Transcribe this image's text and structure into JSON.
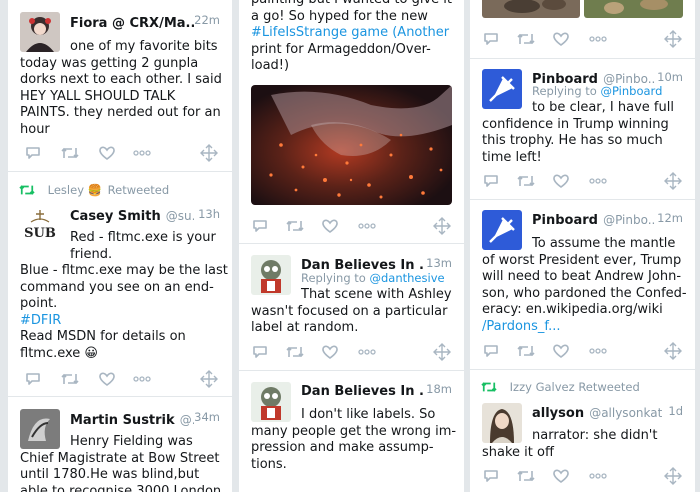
{
  "tweets": [
    {
      "name": "Fiora @ CRX/Ma...",
      "time": "22m",
      "text_lines": [
        "one of my favorite bits",
        "today was getting 2 gunpla",
        "dorks next to each other. I said",
        "HEY YALL SHOULD TALK",
        "PAINTS. they nerded out for an",
        "hour"
      ]
    },
    {
      "retweeted_by": "Lesley",
      "retweeted_emoji": "🍔",
      "retweeted_label": "Retweeted",
      "name": "Casey Smith",
      "handle": "@su...",
      "time": "13h",
      "avatar_text": "SUB",
      "text_lines": [
        "Red - fltmc.exe is your",
        "friend.",
        "Blue - fltmc.exe may be the last",
        "command you see on an end-",
        "point.",
        "#DFIR",
        "Read MSDN for details on",
        "fltmc.exe 😀"
      ]
    },
    {
      "name": "Martin Sustrik",
      "handle": "@...",
      "time": "34m",
      "text_lines": [
        "Henry Fielding was",
        "Chief Magistrate at Bow Street",
        "until 1780.He was blind,but",
        "able to recognise 3000 London"
      ]
    },
    {
      "text_lines": [
        "painting but I wanted to give it",
        "a go! So hyped for the new",
        "#LifeIsStrange game (Another",
        "print for Armageddon/Over-",
        "load!)"
      ]
    },
    {
      "name": "Dan Believes In ...",
      "time": "13m",
      "replying_label": "Replying to",
      "replying_handle": "@danthesive",
      "text_lines": [
        "That scene with Ashley",
        "wasn't focused on a particular",
        "label at random."
      ]
    },
    {
      "name": "Dan Believes In ...",
      "time": "18m",
      "text_lines": [
        "I don't like labels. So",
        "many people get the wrong im-",
        "pression and make assump-",
        "tions."
      ]
    },
    {
      "name": "Pinboard",
      "handle": "@Pinbo...",
      "time": "10m",
      "replying_label": "Replying to",
      "replying_handle": "@Pinboard",
      "text_lines": [
        "to be clear, I have full",
        "confidence in Trump winning",
        "this trophy. He has so much",
        "time left!"
      ]
    },
    {
      "name": "Pinboard",
      "handle": "@Pinbo...",
      "time": "12m",
      "text_lines": [
        "To assume the mantle",
        "of worst President ever, Trump",
        "will need to beat Andrew John-",
        "son, who pardoned the Confed-",
        "eracy: en.wikipedia.org/wiki",
        "/Pardons_f..."
      ]
    },
    {
      "retweeted_by": "Izzy Galvez",
      "retweeted_label": "Retweeted",
      "name": "allyson",
      "handle": "@allysonkate",
      "time": "1d",
      "text_lines": [
        "narrator: she didn't",
        "shake it off"
      ]
    }
  ],
  "colors": {
    "background": "#e3e7ea",
    "card": "#ffffff",
    "link": "#1b95e0",
    "retweet_green": "#17bf63",
    "muted": "#8899a6",
    "action_icon": "#a9b6c2"
  },
  "icons": [
    "reply-icon",
    "retweet-icon",
    "like-icon",
    "more-icon",
    "drag-icon"
  ]
}
